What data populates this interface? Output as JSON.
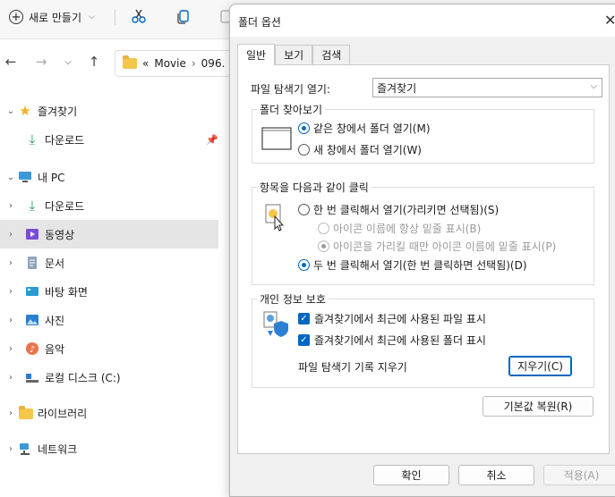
{
  "explorer": {
    "toolbar": {
      "new_label": "새로 만들기"
    },
    "address": {
      "prefix": "«",
      "segment1": "Movie",
      "separator": "›",
      "segment2": "096."
    },
    "sidebar": [
      {
        "name": "favorites",
        "label": "즐겨찾기",
        "expanded": true
      },
      {
        "name": "downloads-pinned",
        "label": "다운로드",
        "pinned": true
      },
      {
        "name": "this-pc",
        "label": "내 PC",
        "expanded": true
      },
      {
        "name": "downloads",
        "label": "다운로드"
      },
      {
        "name": "videos",
        "label": "동영상",
        "selected": true
      },
      {
        "name": "documents",
        "label": "문서"
      },
      {
        "name": "desktop",
        "label": "바탕 화면"
      },
      {
        "name": "pictures",
        "label": "사진"
      },
      {
        "name": "music",
        "label": "음악"
      },
      {
        "name": "local-disk",
        "label": "로컬 디스크 (C:)"
      },
      {
        "name": "libraries",
        "label": "라이브러리"
      },
      {
        "name": "network",
        "label": "네트워크"
      }
    ]
  },
  "dialog": {
    "title": "폴더 옵션",
    "close": "✕",
    "tabs": [
      "일반",
      "보기",
      "검색"
    ],
    "open_explorer_label": "파일 탐색기 열기:",
    "open_explorer_value": "즐겨찾기",
    "browse": {
      "title": "폴더 찾아보기",
      "option1": "같은 창에서 폴더 열기(M)",
      "option2": "새 창에서 폴더 열기(W)"
    },
    "click": {
      "title": "항목을 다음과 같이 클릭",
      "single": "한 번 클릭해서 열기(가리키면 선택됨)(S)",
      "sub1": "아이콘 이름에 항상 밑줄 표시(B)",
      "sub2": "아이콘을 가리킬 때만 아이콘 이름에 밑줄 표시(P)",
      "double": "두 번 클릭해서 열기(한 번 클릭하면 선택됨)(D)"
    },
    "privacy": {
      "title": "개인 정보 보호",
      "check1": "즐겨찾기에서 최근에 사용된 파일 표시",
      "check2": "즐겨찾기에서 최근에 사용된 폴더 표시",
      "clear_label": "파일 탐색기 기록 지우기",
      "clear_button": "지우기(C)"
    },
    "restore_button": "기본값 복원(R)",
    "ok_button": "확인",
    "cancel_button": "취소",
    "apply_button": "적용(A)"
  }
}
